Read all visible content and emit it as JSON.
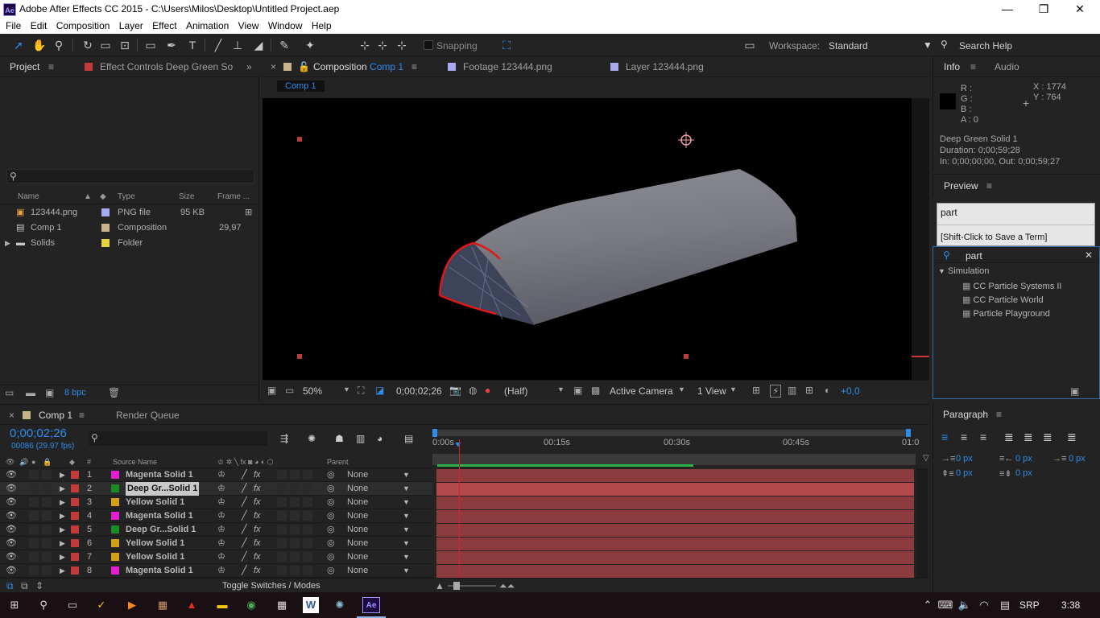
{
  "window": {
    "logo": "Ae",
    "title": "Adobe After Effects CC 2015 - C:\\Users\\Milos\\Desktop\\Untitled Project.aep",
    "minimize": "—",
    "restore": "❐",
    "close": "✕"
  },
  "menu": [
    "File",
    "Edit",
    "Composition",
    "Layer",
    "Effect",
    "Animation",
    "View",
    "Window",
    "Help"
  ],
  "toolbar": {
    "snapping_label": "Snapping",
    "workspace_label": "Workspace:",
    "workspace_value": "Standard",
    "search_help": "Search Help"
  },
  "project_panel": {
    "tab_project": "Project",
    "tab_effect_controls": "Effect Controls Deep Green So",
    "columns": {
      "name": "Name",
      "type": "Type",
      "size": "Size",
      "frame": "Frame ..."
    },
    "items": [
      {
        "name": "123444.png",
        "type": "PNG file",
        "size": "95 KB",
        "frame": "",
        "label_color": "#a9a9ee"
      },
      {
        "name": "Comp 1",
        "type": "Composition",
        "size": "",
        "frame": "29,97",
        "label_color": "#c9b38a"
      },
      {
        "name": "Solids",
        "type": "Folder",
        "size": "",
        "frame": "",
        "label_color": "#e3d343"
      }
    ],
    "bpc": "8 bpc",
    "expand_arrow": "▶"
  },
  "viewer_tabs": {
    "composition_prefix": "Composition",
    "composition_name": "Comp 1",
    "footage": "Footage  123444.png",
    "layer": "Layer  123444.png",
    "breadcrumb": "Comp 1"
  },
  "viewer_footer": {
    "zoom": "50%",
    "timecode": "0;00;02;26",
    "resolution": "(Half)",
    "camera": "Active Camera",
    "views": "1 View",
    "exposure": "+0,0"
  },
  "info_panel": {
    "tab_info": "Info",
    "tab_audio": "Audio",
    "r": "R :",
    "g": "G :",
    "b": "B :",
    "a": "A : 0",
    "x": "X : 1774",
    "y": "Y : 764",
    "layer_name": "Deep Green Solid 1",
    "duration": "Duration: 0;00;59;28",
    "in_out": "In: 0;00;00;00, Out: 0;00;59;27"
  },
  "preview_panel": {
    "tab": "Preview",
    "search_history": "part",
    "tooltip": "[Shift-Click to Save a Term]"
  },
  "effects_panel": {
    "search_value": "part",
    "category": "Simulation",
    "effects": [
      "CC Particle Systems II",
      "CC Particle World",
      "Particle Playground"
    ]
  },
  "timeline": {
    "tab_comp": "Comp 1",
    "tab_render": "Render Queue",
    "timecode": "0;00;02;26",
    "frame_info": "00086 (29.97 fps)",
    "col_number": "#",
    "col_source": "Source Name",
    "col_parent": "Parent",
    "ruler": [
      "0:00s",
      "00:15s",
      "00:30s",
      "00:45s",
      "01:0"
    ],
    "toggle_label": "Toggle Switches / Modes",
    "layers": [
      {
        "num": "1",
        "name": "Magenta Solid 1",
        "color": "#e21ed0",
        "parent": "None"
      },
      {
        "num": "2",
        "name": "Deep Gr...Solid 1",
        "color": "#1d8a2a",
        "parent": "None"
      },
      {
        "num": "3",
        "name": "Yellow Solid 1",
        "color": "#d4a017",
        "parent": "None"
      },
      {
        "num": "4",
        "name": "Magenta Solid 1",
        "color": "#e21ed0",
        "parent": "None"
      },
      {
        "num": "5",
        "name": "Deep Gr...Solid 1",
        "color": "#1d8a2a",
        "parent": "None"
      },
      {
        "num": "6",
        "name": "Yellow Solid 1",
        "color": "#d4a017",
        "parent": "None"
      },
      {
        "num": "7",
        "name": "Yellow Solid 1",
        "color": "#d4a017",
        "parent": "None"
      },
      {
        "num": "8",
        "name": "Magenta Solid 1",
        "color": "#e21ed0",
        "parent": "None"
      }
    ]
  },
  "paragraph_panel": {
    "tab": "Paragraph",
    "indent_left": "0 px",
    "indent_right": "0 px",
    "indent_first": "0 px",
    "space_before": "0 px",
    "space_after": "0 px"
  },
  "taskbar": {
    "lang": "SRP",
    "time": "3:38"
  }
}
